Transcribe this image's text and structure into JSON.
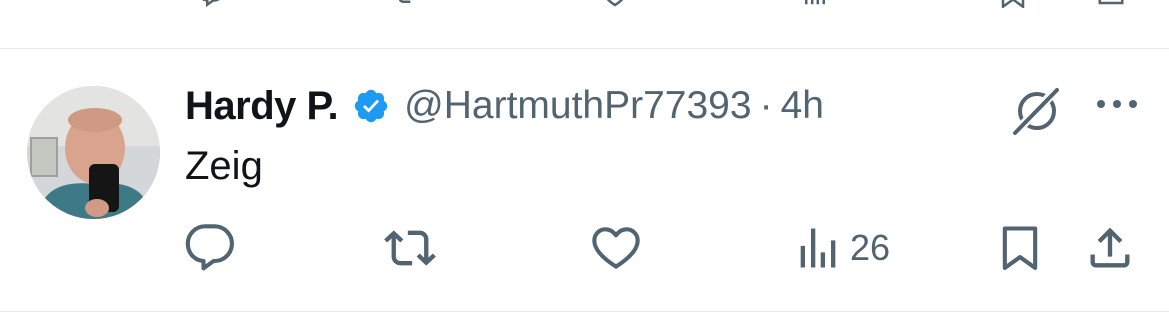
{
  "tweet": {
    "author": {
      "display_name": "Hardy P.",
      "handle": "@HartmuthPr77393",
      "verified": true,
      "avatar_icon": "avatar-photo"
    },
    "separator": "·",
    "timestamp": "4h",
    "text": "Zeig",
    "actions": {
      "reply_count": "",
      "retweet_count": "",
      "like_count": "",
      "views_count": "26",
      "bookmark_icon": "bookmark-icon",
      "share_icon": "share-icon"
    },
    "header_icons": [
      "grok-icon",
      "more-icon"
    ]
  },
  "colors": {
    "text_primary": "#0f1419",
    "text_secondary": "#536471",
    "verified_blue": "#1d9bf0",
    "divider": "#e6e9ec"
  }
}
